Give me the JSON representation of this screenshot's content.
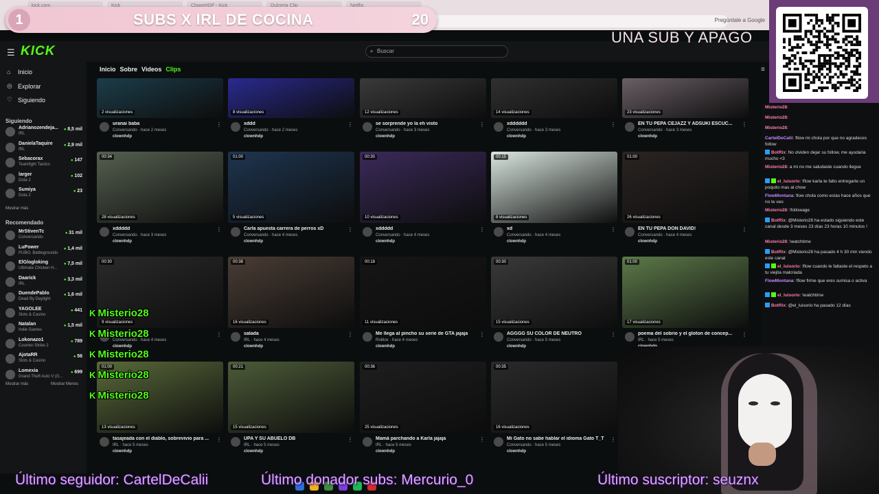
{
  "browser": {
    "tabs": [
      "kick.com",
      "Kick",
      "ClownHDP - Kick",
      "Dulceria Clip",
      "Netflix"
    ],
    "url": "kick.com/clownhdp/clips?sort=date&range=all",
    "ask_google": "Pregúntale a Google"
  },
  "overlay": {
    "goal_number": "1",
    "goal_title": "SUBS X IRL DE COCINA",
    "goal_count": "20",
    "corner_text": "UNA SUB Y APAGO",
    "ticker_follower": "Último seguidor: CartelDeCalii",
    "ticker_donor": "Último donador subs: Mercurio_0",
    "ticker_sub": "Último suscriptor: seuznx",
    "alerts": [
      "Misterio28",
      "Misterio28",
      "Misterio28",
      "Misterio28",
      "Misterio28"
    ]
  },
  "topbar": {
    "logo": "KICK",
    "search_placeholder": "Buscar"
  },
  "sidebar": {
    "nav": [
      {
        "label": "Inicio",
        "icon": "home-icon"
      },
      {
        "label": "Explorar",
        "icon": "compass-icon"
      },
      {
        "label": "Siguiendo",
        "icon": "heart-icon"
      }
    ],
    "following_title": "Siguiendo",
    "following": [
      {
        "name": "Adrianozendeja...",
        "game": "IRL",
        "viewers": "8,5 mil"
      },
      {
        "name": "DanielaTaquire",
        "game": "IRL",
        "viewers": "2,9 mil"
      },
      {
        "name": "Sebacorax",
        "game": "Teamfight Tactics",
        "viewers": "147"
      },
      {
        "name": "larger",
        "game": "Dota 2",
        "viewers": "102"
      },
      {
        "name": "Sumiya",
        "game": "Dota 2",
        "viewers": "23"
      }
    ],
    "show_more_1": "Mostrar más",
    "recommended_title": "Recomendado",
    "recommended": [
      {
        "name": "MrStivenTc",
        "game": "Conversando",
        "viewers": "31 mil"
      },
      {
        "name": "LuPower",
        "game": "PUBG: Battlegrounds",
        "viewers": "1,4 mil"
      },
      {
        "name": "ElGlogloking",
        "game": "Ultimate Chicken H...",
        "viewers": "7,5 mil"
      },
      {
        "name": "Daarick",
        "game": "IRL",
        "viewers": "3,3 mil"
      },
      {
        "name": "DuendePablo",
        "game": "Dead By Daylight",
        "viewers": "1,6 mil"
      },
      {
        "name": "YAGOLEE",
        "game": "Slots & Casino",
        "viewers": "441"
      },
      {
        "name": "Natalan",
        "game": "Indie Games",
        "viewers": "1,5 mil"
      },
      {
        "name": "Lokonazo1",
        "game": "Counter-Strike 2",
        "viewers": "789"
      },
      {
        "name": "AjotaRR",
        "game": "Slots & Casino",
        "viewers": "56"
      },
      {
        "name": "Lomexia",
        "game": "Grand Theft Auto V (G...",
        "viewers": "699"
      }
    ],
    "show_more_2": "Mostrar más",
    "show_less": "Mostrar Menos"
  },
  "channel_tabs": [
    "Inicio",
    "Sobre",
    "Videos",
    "Clips"
  ],
  "clips": [
    {
      "title": "uranai baba",
      "sub": "Conversando · hace 2 meses",
      "channel": "clownhdp",
      "views": "2 visualizaciones",
      "dur": "",
      "color": "#1c3d4a"
    },
    {
      "title": "xddd",
      "sub": "Conversando · hace 2 meses",
      "channel": "clownhdp",
      "views": "8 visualizaciones",
      "dur": "",
      "color": "#2a2a8f"
    },
    {
      "title": "se sorprende yo la eh visto",
      "sub": "Conversando · hace 3 meses",
      "channel": "clownhdp",
      "views": "12 visualizaciones",
      "dur": "",
      "color": "#3a3a3a"
    },
    {
      "title": "xdddddd",
      "sub": "Conversando · hace 3 meses",
      "channel": "clownhdp",
      "views": "14 visualizaciones",
      "dur": "",
      "color": "#303030"
    },
    {
      "title": "EN TU PEPA CEJAZZ Y ADSUKI ESCUC...",
      "sub": "Conversando · hace 3 meses",
      "channel": "clownhdp",
      "views": "23 visualizaciones",
      "dur": "",
      "color": "#6a5f66"
    },
    {
      "title": "xddddd",
      "sub": "Conversando · hace 3 meses",
      "channel": "clownhdp",
      "views": "28 visualizaciones",
      "dur": "00:34",
      "color": "#556050"
    },
    {
      "title": "Carla apuesta carrera de perros xD",
      "sub": "Conversando · hace 4 meses",
      "channel": "clownhdp",
      "views": "5 visualizaciones",
      "dur": "01:00",
      "color": "#1e3550"
    },
    {
      "title": "xddddd",
      "sub": "Conversando · hace 4 meses",
      "channel": "clownhdp",
      "views": "10 visualizaciones",
      "dur": "00:30",
      "color": "#3b2a5a"
    },
    {
      "title": "xd",
      "sub": "Conversando · hace 4 meses",
      "channel": "clownhdp",
      "views": "8 visualizaciones",
      "dur": "00:15",
      "color": "#d9e6de"
    },
    {
      "title": "EN TU PEPA DON DAVID!",
      "sub": "Conversando · hace 4 meses",
      "channel": "clownhdp",
      "views": "26 visualizaciones",
      "dur": "01:00",
      "color": "#2a2422"
    },
    {
      "title": "xddd",
      "sub": "Conversando · hace 4 meses",
      "channel": "clownhdp",
      "views": "9 visualizaciones",
      "dur": "00:30",
      "color": "#2a2a2a"
    },
    {
      "title": "salada",
      "sub": "IRL · hace 4 meses",
      "channel": "clownhdp",
      "views": "16 visualizaciones",
      "dur": "00:38",
      "color": "#4a3d35"
    },
    {
      "title": "Me llega al pincho su serie de GTA jajaja",
      "sub": "Roblox · hace 4 meses",
      "channel": "clownhdp",
      "views": "11 visualizaciones",
      "dur": "00:18",
      "color": "#151515"
    },
    {
      "title": "AGGGG SU COLOR DE NEUTRO",
      "sub": "Conversando · hace 5 meses",
      "channel": "clownhdp",
      "views": "15 visualizaciones",
      "dur": "00:30",
      "color": "#3a3a3a"
    },
    {
      "title": "poema del sobrio y el gloton de concep...",
      "sub": "IRL · hace 5 meses",
      "channel": "clownhdp",
      "views": "17 visualizaciones",
      "dur": "01:00",
      "color": "#5d7a4a"
    },
    {
      "title": "tasajeada con el diablo, sobrevivio para ...",
      "sub": "IRL · hace 5 meses",
      "channel": "clownhdp",
      "views": "13 visualizaciones",
      "dur": "01:00",
      "color": "#5a6a3a"
    },
    {
      "title": "UPA Y SU ABUELO DB",
      "sub": "IRL · hace 5 meses",
      "channel": "clownhdp",
      "views": "15 visualizaciones",
      "dur": "00:21",
      "color": "#4d5c38"
    },
    {
      "title": "Mamá parchando a Karla jajaja",
      "sub": "IRL · hace 5 meses",
      "channel": "clownhdp",
      "views": "25 visualizaciones",
      "dur": "00:36",
      "color": "#1e1e1e"
    },
    {
      "title": "Mi Gato no sabe hablar el idioma Gato T_T",
      "sub": "Conversando · hace 5 meses",
      "channel": "clownhdp",
      "views": "16 visualizaciones",
      "dur": "00:35",
      "color": "#2a2a2a"
    }
  ],
  "chat": [
    {
      "user": "Misterio28",
      "text": ":",
      "color": "#ff7fb0",
      "badge": ""
    },
    {
      "user": "Misterio28",
      "text": ":",
      "color": "#ff7fb0",
      "badge": ""
    },
    {
      "user": "Misterio28",
      "text": ":",
      "color": "#ff7fb0",
      "badge": ""
    },
    {
      "user": "CartelDeCalii",
      "text": ": fllow mi chola por que no agradeces follow",
      "color": "#c78cff",
      "badge": ""
    },
    {
      "user": "BotRix",
      "text": ": No olviden dejar su follow, me ayudaria mucho <3",
      "color": "#ff7fb0",
      "badge": "b"
    },
    {
      "user": "Misterio28",
      "text": ": a mi no me saludaste cuando llegue",
      "color": "#ff7fb0",
      "badge": ""
    },
    {
      "user": "el_luisorio",
      "text": ": !flow karla te falto entregarte un poquito mas al chow",
      "color": "#ff7fb0",
      "badge": "bg"
    },
    {
      "user": "FlowMontana",
      "text": ": flow chola como estas hace años que no te veo",
      "color": "#c78cff",
      "badge": ""
    },
    {
      "user": "Misterio28",
      "text": ": !followage",
      "color": "#ff7fb0",
      "badge": ""
    },
    {
      "user": "BotRix",
      "text": ": @Misterio28 ha estado siguiendo este canal desde 3 meses 23 días 23 horas 10 minutos !",
      "color": "#ff7fb0",
      "badge": "b"
    },
    {
      "user": "Misterio28",
      "text": ": !watchtime",
      "color": "#ff7fb0",
      "badge": ""
    },
    {
      "user": "BotRix",
      "text": ": @Misterio28 ha pasado 4 h 30 min viendo este canal",
      "color": "#ff7fb0",
      "badge": "b"
    },
    {
      "user": "el_luisorio",
      "text": ": !flow cuando le faltaste el respeto a tu viejita malcriada",
      "color": "#ff7fb0",
      "badge": "bg"
    },
    {
      "user": "FlowMontana",
      "text": ": !flow firme que eres sumisa o activa",
      "color": "#c78cff",
      "badge": ""
    },
    {
      "user": "el_luisorio",
      "text": ": !watchtime",
      "color": "#ff7fb0",
      "badge": "bg"
    },
    {
      "user": "BotRix",
      "text": ": @el_luisorio ha pasado 12 días",
      "color": "#ff7fb0",
      "badge": "b"
    }
  ]
}
